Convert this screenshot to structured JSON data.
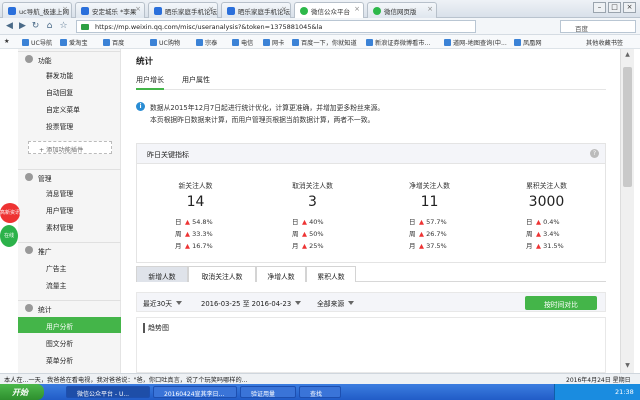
{
  "browser": {
    "tabs": [
      {
        "label": "uc导航_极速上网",
        "icon": "uc-icon"
      },
      {
        "label": "安定城乐 *李果",
        "icon": "page-icon"
      },
      {
        "label": "晒乐家庭手机论坛",
        "icon": "page-icon"
      },
      {
        "label": "晒乐家庭手机论坛",
        "icon": "page-icon"
      },
      {
        "label": "微信公众平台",
        "icon": "wechat-icon"
      },
      {
        "label": "微信网页版",
        "icon": "wechat-icon"
      }
    ],
    "url": "https://mp.weixin.qq.com/misc/useranalysis?&token=1375881045&la",
    "search_placeholder": "百度",
    "bookmarks": [
      "UC导航",
      "爱淘宝",
      "百度",
      "UC购物",
      "宗泰",
      "电信",
      "网卡",
      "百度一下，你就知道",
      "新浪证券微博看市...",
      "道网-地图查询(中...",
      "凤凰网"
    ],
    "bookmarks_extra": "其他收藏书签"
  },
  "sidebar": {
    "sections": [
      {
        "title": "功能",
        "items": [
          "群发功能",
          "自动回复",
          "自定义菜单",
          "投票管理"
        ]
      },
      {
        "title": "管理",
        "items": [
          "消息管理",
          "用户管理",
          "素材管理"
        ]
      },
      {
        "title": "推广",
        "items": [
          "广告主",
          "流量主"
        ]
      },
      {
        "title": "统计",
        "items": [
          "用户分析",
          "图文分析",
          "菜单分析"
        ]
      }
    ],
    "add_plugin": "添加功能插件",
    "float_red": "高新资讯",
    "float_green": "在线"
  },
  "main": {
    "title": "统计",
    "subtabs": [
      "用户增长",
      "用户属性"
    ],
    "notice": [
      "数据从2015年12月7日起进行统计优化，计算更准确，并增加更多粉丝来源。",
      "本页根据昨日数据来计算，而用户管理页根据当前数据计算，两者不一致。"
    ],
    "kpi": {
      "title": "昨日关键指标",
      "help": "?",
      "period_labels": [
        "日",
        "周",
        "月"
      ],
      "columns": [
        {
          "label": "新关注人数",
          "value": "14",
          "changes": [
            {
              "dir": "up",
              "pct": "54.8%"
            },
            {
              "dir": "up",
              "pct": "33.3%"
            },
            {
              "dir": "up",
              "pct": "16.7%"
            }
          ]
        },
        {
          "label": "取消关注人数",
          "value": "3",
          "changes": [
            {
              "dir": "up",
              "pct": "40%"
            },
            {
              "dir": "up",
              "pct": "50%"
            },
            {
              "dir": "up",
              "pct": "25%"
            }
          ]
        },
        {
          "label": "净增关注人数",
          "value": "11",
          "changes": [
            {
              "dir": "up",
              "pct": "57.7%"
            },
            {
              "dir": "up",
              "pct": "26.7%"
            },
            {
              "dir": "up",
              "pct": "37.5%"
            }
          ]
        },
        {
          "label": "累积关注人数",
          "value": "3000",
          "changes": [
            {
              "dir": "up",
              "pct": "0.4%"
            },
            {
              "dir": "up",
              "pct": "3.4%"
            },
            {
              "dir": "up",
              "pct": "31.5%"
            }
          ]
        }
      ]
    },
    "data_tabs": [
      "新增人数",
      "取消关注人数",
      "净增人数",
      "累积人数"
    ],
    "filters": {
      "range": "最近30天",
      "date_from": "2016-03-25",
      "date_to_word": "至",
      "date_to": "2016-04-23",
      "source": "全部来源",
      "compare_button": "按时间对比"
    },
    "trend_title": "趋势图"
  },
  "status_bar": "本人在...一天，我爸爸在看电视，我对爸爸说：\"爸，你口吐真言，说了个玩笑吗哪样的...",
  "taskbar": {
    "start": "开始",
    "tasks": [
      "微信公众平台 - U...",
      "20160424宣其李日...",
      "验证用量",
      "查找"
    ],
    "clock": "21:38",
    "date": "2016年4月24日 星期日"
  }
}
